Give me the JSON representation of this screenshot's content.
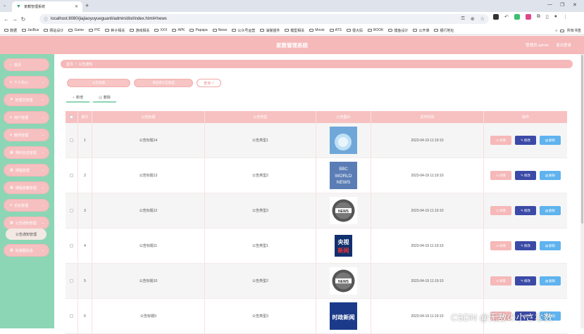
{
  "browser": {
    "tab_title": "家教管理系统",
    "url": "localhost:8080/jiajiaoyuyueguanli/admin/dist/index.html#/news",
    "bookmarks": [
      "数据",
      "JavBus",
      "网站设计",
      "Game",
      "PIC",
      "种子相关",
      "游戏相关",
      "XXX",
      "APK",
      "Papapa",
      "News",
      "公众号运营",
      "油猴插件",
      "模型相关",
      "Movie",
      "ATS",
      "很大妈",
      "BOOK",
      "摸鱼设计",
      "公开课",
      "银行地址"
    ],
    "bookmarks_all": "所有书签"
  },
  "header": {
    "title": "家教管理系统",
    "admin_label": "管理员 admin",
    "logout_label": "退出登录"
  },
  "sidebar": {
    "items": [
      {
        "label": "首页",
        "icon": "home-icon"
      },
      {
        "label": "个人中心",
        "icon": "user-icon"
      },
      {
        "label": "管理员管理",
        "icon": "flag-icon"
      },
      {
        "label": "用户管理",
        "icon": "user-icon"
      },
      {
        "label": "教师管理",
        "icon": "user-icon"
      },
      {
        "label": "预约信息管理",
        "icon": "grid-icon"
      },
      {
        "label": "课程管理",
        "icon": "grid-icon"
      },
      {
        "label": "课程收藏管理",
        "icon": "grid-icon"
      },
      {
        "label": "论坛管理",
        "icon": "user-icon"
      },
      {
        "label": "公告通知管理",
        "icon": "grid-icon"
      },
      {
        "label": "轮播图信息",
        "icon": "grid-icon"
      }
    ],
    "active_sub": "公告通知管理"
  },
  "breadcrumb": {
    "home": "首页",
    "sep": "/",
    "current": "公告通知"
  },
  "search": {
    "title_placeholder": "公告标题",
    "type_placeholder": "请选择公告类型",
    "button": "查询"
  },
  "actions": {
    "add": "新增",
    "delete": "删除"
  },
  "table": {
    "headers": [
      "",
      "索引",
      "公告标题",
      "公告类型",
      "公告图片",
      "发布时间",
      "操作"
    ],
    "rows": [
      {
        "index": "1",
        "title": "公告标题14",
        "type": "公告类型1",
        "image": "globe-news",
        "time": "2023-04-19 11:19:10"
      },
      {
        "index": "2",
        "title": "公告标题13",
        "type": "公告类型2",
        "image": "bbc-world-news",
        "time": "2023-04-19 11:19:10"
      },
      {
        "index": "3",
        "title": "公告标题12",
        "type": "公告类型3",
        "image": "news-circle",
        "time": "2023-04-19 11:19:10"
      },
      {
        "index": "4",
        "title": "公告标题11",
        "type": "公告类型1",
        "image": "cctv-news",
        "time": "2023-04-19 11:19:10"
      },
      {
        "index": "5",
        "title": "公告标题10",
        "type": "公告类型2",
        "image": "news-circle",
        "time": "2023-04-19 11:19:10"
      },
      {
        "index": "6",
        "title": "公告标题9",
        "type": "公告类型3",
        "image": "politics-news",
        "time": "2023-04-19 11:19:10"
      }
    ],
    "buttons": {
      "detail": "详情",
      "edit": "修改",
      "delete": "删除"
    }
  },
  "watermark": "CSDN @无敌の小さな数",
  "colors": {
    "header": "#f5b9b9",
    "sidebar": "#8cd6b6",
    "edit": "#3b4aa6",
    "delete": "#5fb3ee"
  }
}
